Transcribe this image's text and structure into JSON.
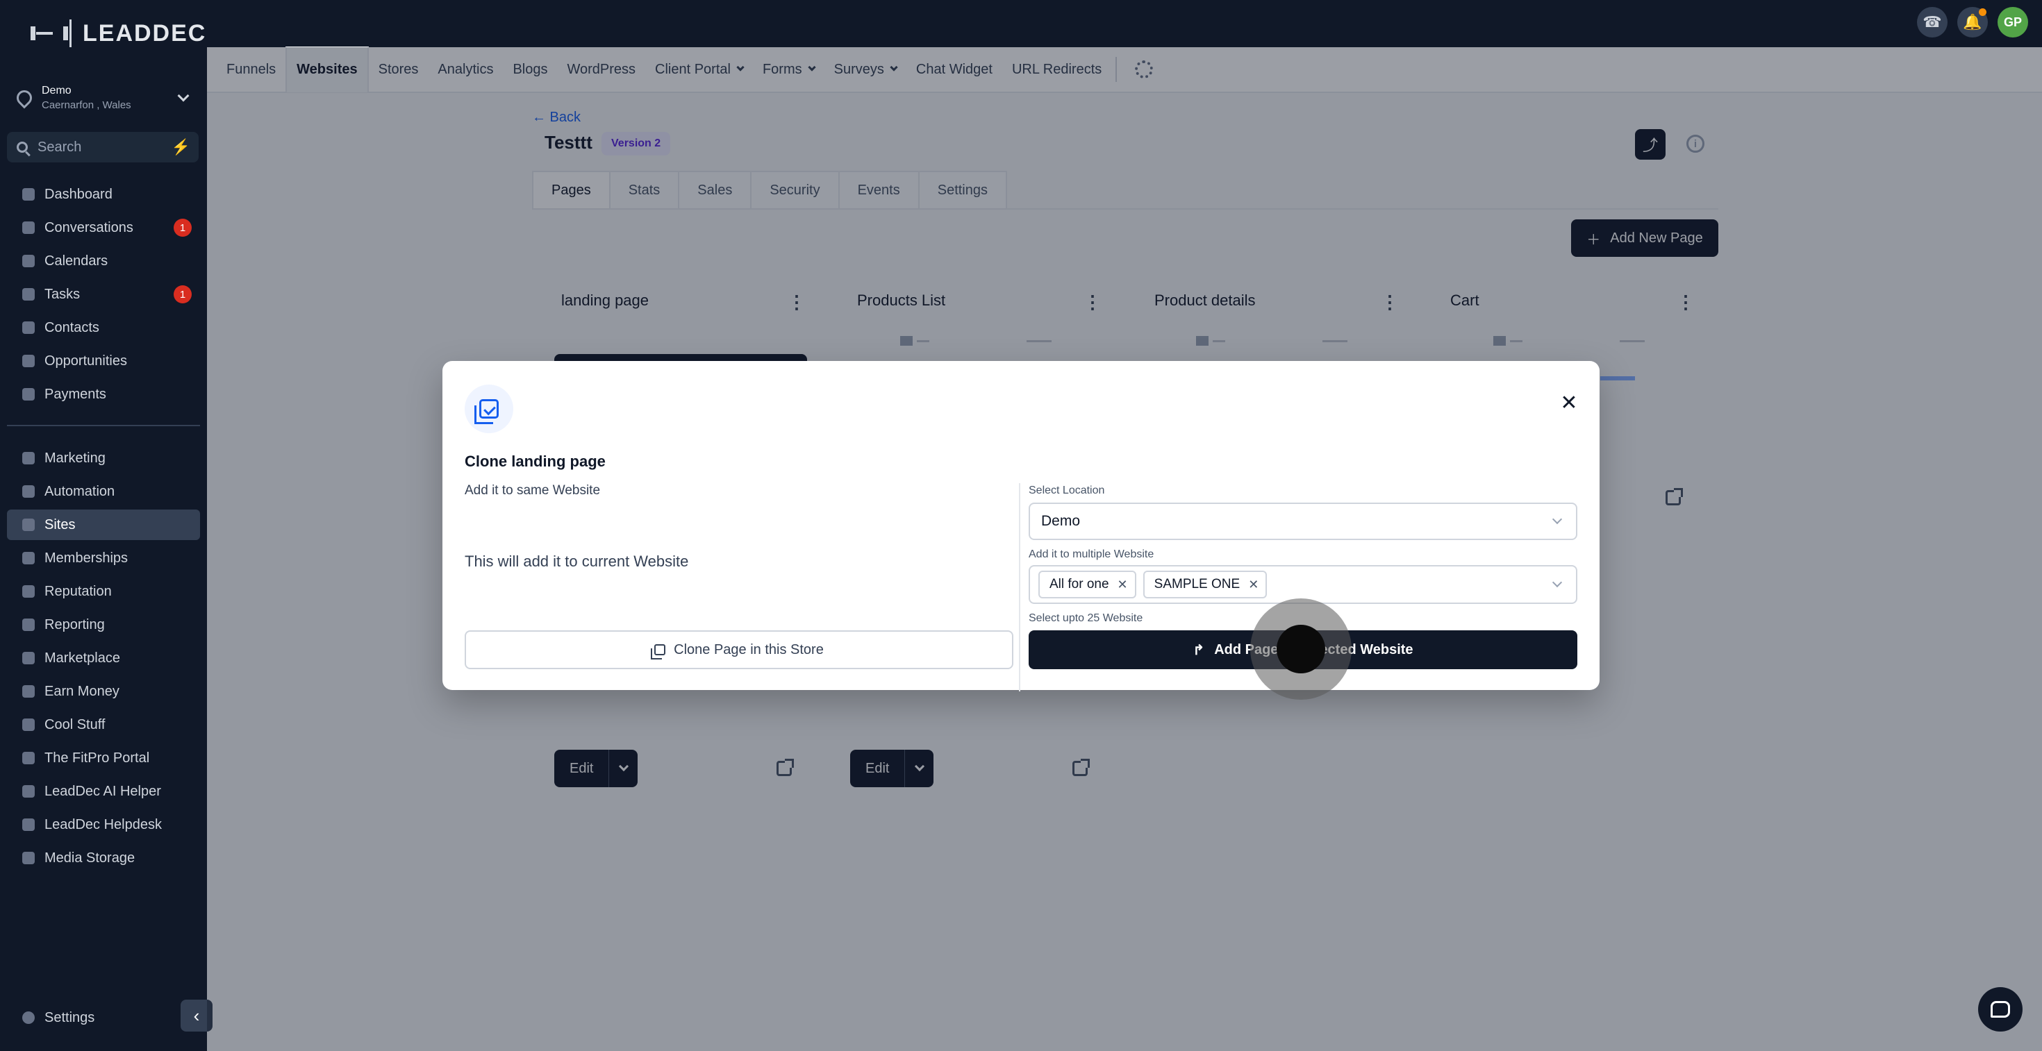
{
  "app": {
    "logo_text": "LEADDEC"
  },
  "location": {
    "name": "Demo",
    "sub": "Caernarfon , Wales"
  },
  "search": {
    "placeholder": "Search"
  },
  "sidebar": {
    "items": [
      {
        "label": "Dashboard"
      },
      {
        "label": "Conversations",
        "badge": "1"
      },
      {
        "label": "Calendars"
      },
      {
        "label": "Tasks",
        "badge": "1"
      },
      {
        "label": "Contacts"
      },
      {
        "label": "Opportunities"
      },
      {
        "label": "Payments"
      },
      {
        "label": "Marketing"
      },
      {
        "label": "Automation"
      },
      {
        "label": "Sites",
        "active": true
      },
      {
        "label": "Memberships"
      },
      {
        "label": "Reputation"
      },
      {
        "label": "Reporting"
      },
      {
        "label": "Marketplace"
      },
      {
        "label": "Earn Money"
      },
      {
        "label": "Cool Stuff"
      },
      {
        "label": "The FitPro Portal"
      },
      {
        "label": "LeadDec AI Helper"
      },
      {
        "label": "LeadDec Helpdesk"
      },
      {
        "label": "Media Storage"
      }
    ],
    "settings_label": "Settings"
  },
  "topbar": {
    "avatar_initials": "GP"
  },
  "subnav": {
    "items": [
      "Funnels",
      "Websites",
      "Stores",
      "Analytics",
      "Blogs",
      "WordPress",
      "Client Portal",
      "Forms",
      "Surveys",
      "Chat Widget",
      "URL Redirects"
    ],
    "active": "Websites"
  },
  "page": {
    "back_label": "← Back",
    "title": "Testtt",
    "version_badge": "Version 2",
    "tabs": [
      "Pages",
      "Stats",
      "Sales",
      "Security",
      "Events",
      "Settings"
    ],
    "active_tab": "Pages",
    "add_page_label": "Add New Page",
    "cards": [
      {
        "title": "landing page"
      },
      {
        "title": "Products List"
      },
      {
        "title": "Product details"
      },
      {
        "title": "Cart"
      }
    ],
    "edit_label": "Edit"
  },
  "modal": {
    "title": "Clone landing page",
    "left_label": "Add it to same Website",
    "left_description": "This will add it to current Website",
    "select_location_label": "Select Location",
    "select_location_value": "Demo",
    "multi_label": "Add it to multiple Website",
    "chips": [
      "All for one",
      "SAMPLE ONE"
    ],
    "hint": "Select upto 25 Website",
    "clone_button": "Clone Page in this Store",
    "add_button": "Add Page to Selected Website"
  },
  "colors": {
    "sidebar_bg": "#101828",
    "accent": "#155eef",
    "badge_red": "#d92d20",
    "version_badge_bg": "#ebe9fe"
  }
}
